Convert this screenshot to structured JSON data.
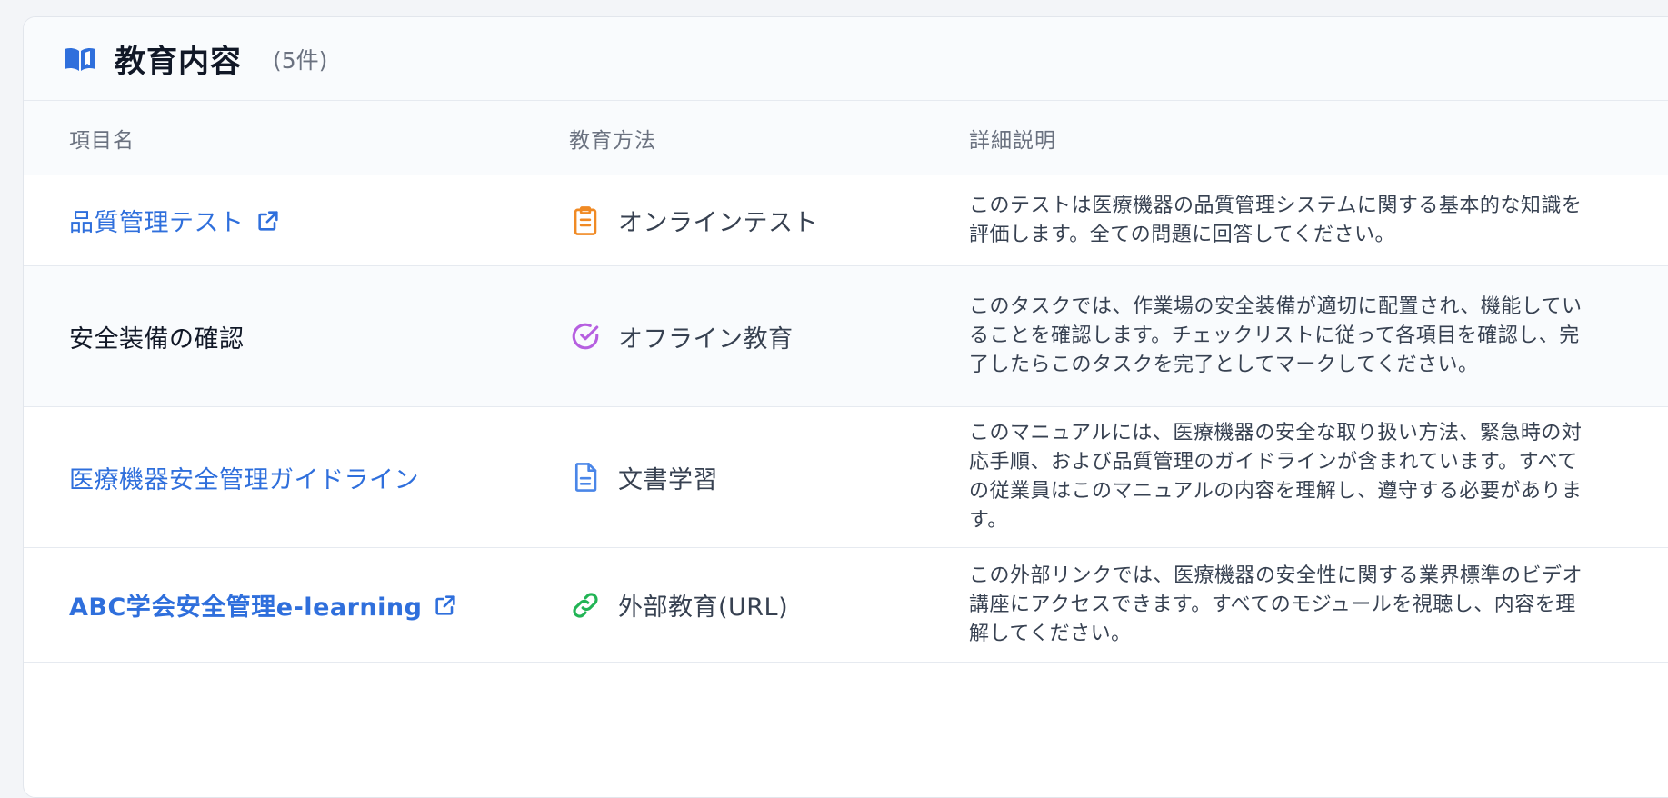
{
  "header": {
    "title": "教育内容",
    "count": "(5件)"
  },
  "table": {
    "columns": [
      "項目名",
      "教育方法",
      "詳細説明"
    ],
    "rows": [
      {
        "name": "品質管理テスト",
        "method": "オンラインテスト",
        "method_icon": "clipboard-icon",
        "description": "このテストは医療機器の品質管理システムに関する基本的な知識を評価します。全ての問題に回答してください。"
      },
      {
        "name": "安全装備の確認",
        "method": "オフライン教育",
        "method_icon": "check-circle-icon",
        "description": "このタスクでは、作業場の安全装備が適切に配置され、機能していることを確認します。チェックリストに従って各項目を確認し、完了したらこのタスクを完了としてマークしてください。"
      },
      {
        "name": "医療機器安全管理ガイドライン",
        "method": "文書学習",
        "method_icon": "document-icon",
        "description": "このマニュアルには、医療機器の安全な取り扱い方法、緊急時の対応手順、および品質管理のガイドラインが含まれています。すべての従業員はこのマニュアルの内容を理解し、遵守する必要があります。"
      },
      {
        "name": "ABC学会安全管理e-learning",
        "method": "外部教育(URL)",
        "method_icon": "link-icon",
        "description": "この外部リンクでは、医療機器の安全性に関する業界標準のビデオ講座にアクセスできます。すべてのモジュールを視聴し、内容を理解してください。"
      }
    ]
  },
  "colors": {
    "link": "#2f6fdc",
    "clipboard": "#f08a24",
    "check": "#b65fe0",
    "document": "#4a86e8",
    "link_icon": "#22b455"
  }
}
